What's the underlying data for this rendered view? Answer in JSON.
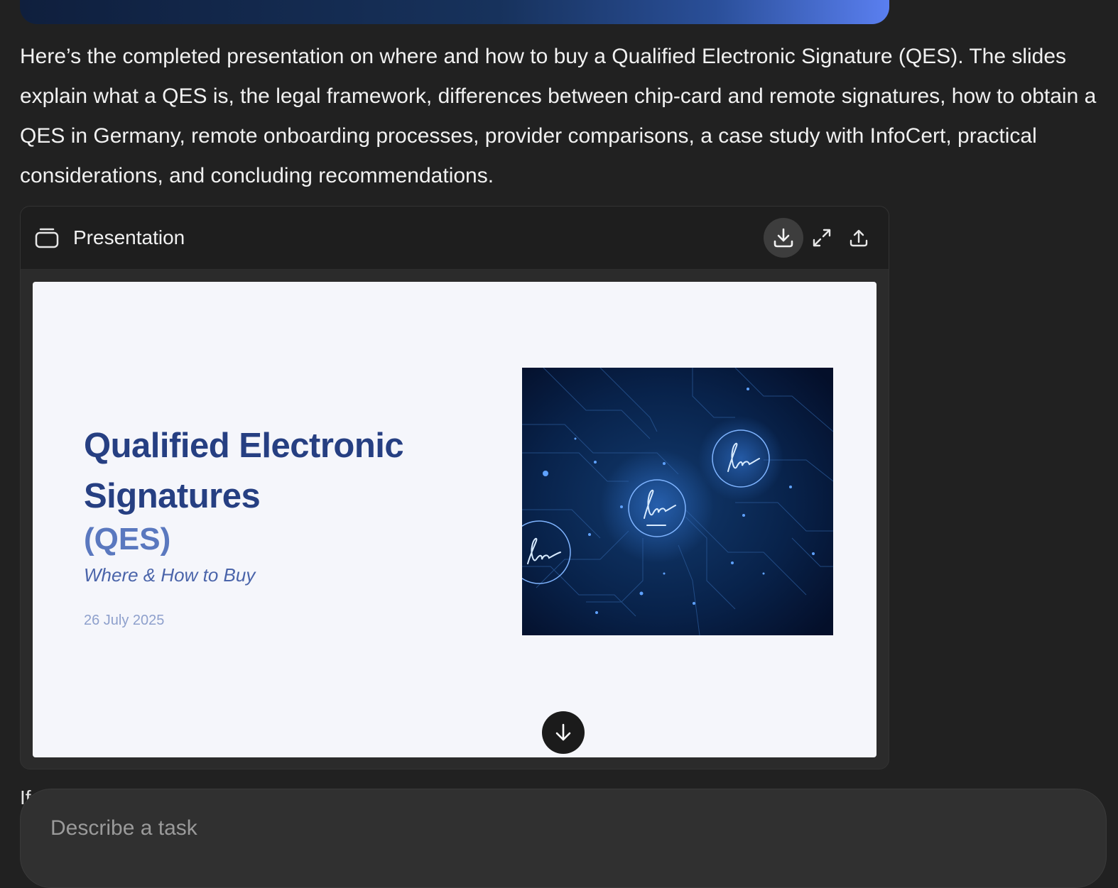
{
  "message": {
    "text": "Here’s the completed presentation on where and how to buy a Qualified Electronic Signature (QES). The slides explain what a QES is, the legal framework, differences between chip-card and remote signatures, how to obtain a QES in Germany, remote onboarding processes, provider comparisons, a case study with InfoCert, practical considerations, and concluding recommendations."
  },
  "artifact": {
    "icon": "presentation-icon",
    "label": "Presentation",
    "actions": {
      "download_icon": "download-icon",
      "expand_icon": "expand-icon",
      "share_icon": "share-icon"
    },
    "slide": {
      "title": "Qualified Electronic Signatures",
      "abbreviation": "(QES)",
      "subtitle": "Where & How to Buy",
      "date": "26 July 2025",
      "image": "digital-signature-circuit-illustration"
    },
    "scroll_icon": "arrow-down-icon"
  },
  "partial_text": "If",
  "composer": {
    "placeholder": "Describe a task"
  },
  "colors": {
    "background": "#212121",
    "slide_title": "#263f82",
    "slide_accent": "#5a78bf"
  }
}
